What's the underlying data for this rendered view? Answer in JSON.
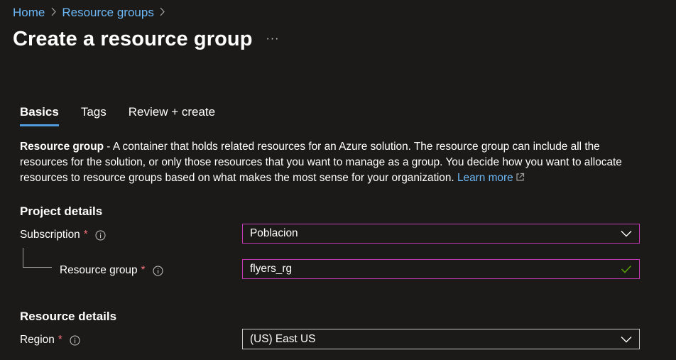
{
  "breadcrumb": {
    "items": [
      {
        "label": "Home"
      },
      {
        "label": "Resource groups"
      }
    ],
    "separator": ">"
  },
  "page": {
    "title": "Create a resource group",
    "more_label": "···"
  },
  "tabs": [
    {
      "label": "Basics",
      "active": true
    },
    {
      "label": "Tags",
      "active": false
    },
    {
      "label": "Review + create",
      "active": false
    }
  ],
  "description": {
    "bold": "Resource group",
    "text": " - A container that holds related resources for an Azure solution. The resource group can include all the resources for the solution, or only those resources that you want to manage as a group. You decide how you want to allocate resources to resource groups based on what makes the most sense for your organization. ",
    "link": "Learn more"
  },
  "project_details": {
    "heading": "Project details",
    "subscription": {
      "label": "Subscription",
      "required": "*",
      "value": "Poblacion"
    },
    "resource_group": {
      "label": "Resource group",
      "required": "*",
      "value": "flyers_rg"
    }
  },
  "resource_details": {
    "heading": "Resource details",
    "region": {
      "label": "Region",
      "required": "*",
      "value": "(US) East US"
    }
  },
  "colors": {
    "background": "#1b1a19",
    "link": "#6cb8f6",
    "focus_border": "#c239b3",
    "valid_check": "#57a300",
    "required": "#f1707b",
    "tab_underline": "#4f9bde"
  },
  "icons": [
    "chevron-right-icon",
    "more-icon",
    "external-link-icon",
    "info-icon",
    "chevron-down-icon",
    "checkmark-icon"
  ]
}
